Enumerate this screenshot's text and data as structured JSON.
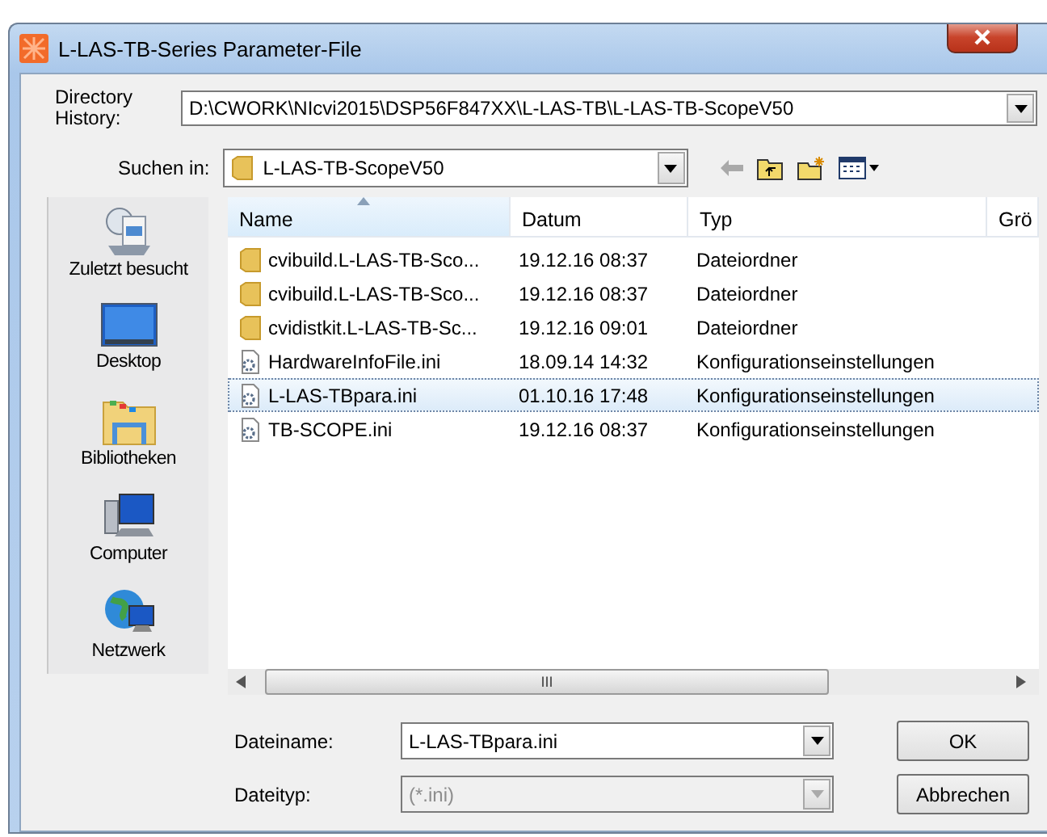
{
  "window": {
    "title": "L-LAS-TB-Series Parameter-File"
  },
  "directory_history": {
    "label": "Directory History:",
    "value": "D:\\CWORK\\NIcvi2015\\DSP56F847XX\\L-LAS-TB\\L-LAS-TB-ScopeV50"
  },
  "look_in": {
    "label": "Suchen in:",
    "value": "L-LAS-TB-ScopeV50"
  },
  "places": [
    {
      "kind": "recent",
      "label": "Zuletzt besucht"
    },
    {
      "kind": "desktop",
      "label": "Desktop"
    },
    {
      "kind": "libraries",
      "label": "Bibliotheken"
    },
    {
      "kind": "computer",
      "label": "Computer"
    },
    {
      "kind": "network",
      "label": "Netzwerk"
    }
  ],
  "table": {
    "columns": [
      "Name",
      "Datum",
      "Typ",
      "Grö"
    ],
    "rows": [
      {
        "kind": "folder",
        "name": "cvibuild.L-LAS-TB-Sco...",
        "date": "19.12.16 08:37",
        "type": "Dateiordner",
        "selected": false
      },
      {
        "kind": "folder",
        "name": "cvibuild.L-LAS-TB-Sco...",
        "date": "19.12.16 08:37",
        "type": "Dateiordner",
        "selected": false
      },
      {
        "kind": "folder",
        "name": "cvidistkit.L-LAS-TB-Sc...",
        "date": "19.12.16 09:01",
        "type": "Dateiordner",
        "selected": false
      },
      {
        "kind": "ini",
        "name": "HardwareInfoFile.ini",
        "date": "18.09.14 14:32",
        "type": "Konfigurationseinstellungen",
        "selected": false
      },
      {
        "kind": "ini",
        "name": "L-LAS-TBpara.ini",
        "date": "01.10.16 17:48",
        "type": "Konfigurationseinstellungen",
        "selected": true
      },
      {
        "kind": "ini",
        "name": "TB-SCOPE.ini",
        "date": "19.12.16 08:37",
        "type": "Konfigurationseinstellungen",
        "selected": false
      }
    ]
  },
  "scrollbar_grip": "III",
  "file_name": {
    "label": "Dateiname:",
    "value": "L-LAS-TBpara.ini"
  },
  "file_type": {
    "label": "Dateityp:",
    "value": "(*.ini)",
    "disabled": true
  },
  "buttons": [
    "OK",
    "Abbrechen"
  ]
}
